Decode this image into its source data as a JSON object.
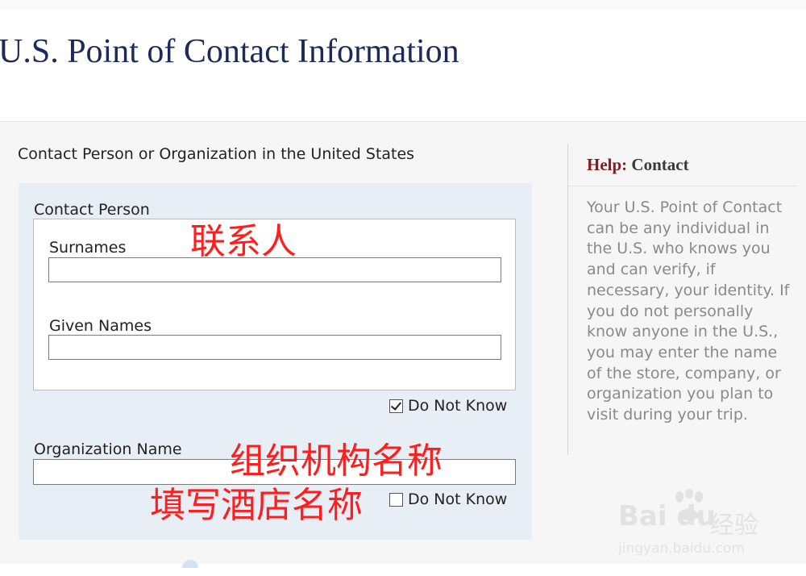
{
  "page": {
    "title": "U.S. Point of Contact Information"
  },
  "form": {
    "section_heading": "Contact Person or Organization in the United States",
    "contact_person": {
      "group_label": "Contact Person",
      "surnames": {
        "label": "Surnames",
        "value": ""
      },
      "given_names": {
        "label": "Given Names",
        "value": ""
      },
      "do_not_know": {
        "label": "Do Not Know",
        "checked": true
      }
    },
    "organization": {
      "label": "Organization Name",
      "value": "",
      "do_not_know": {
        "label": "Do Not Know",
        "checked": false
      }
    }
  },
  "help": {
    "prefix": "Help:",
    "topic": "Contact",
    "text": "Your U.S. Point of Contact can be any individual in the U.S. who knows you and can verify, if necessary, your identity. If you do not personally know anyone in the U.S., you may enter the name of the store, company, or organization you plan to visit during your trip."
  },
  "annotations": {
    "contact_person": "联系人",
    "organization": "组织机构名称",
    "hotel": "填写酒店名称"
  },
  "watermark": {
    "logo": "Bai du",
    "product": "经验",
    "url": "jingyan.baidu.com"
  },
  "colors": {
    "title": "#1c2a5a",
    "annotation": "#ff1d1d",
    "help_prefix": "#8b1a1a",
    "form_panel": "#e8eef5"
  }
}
